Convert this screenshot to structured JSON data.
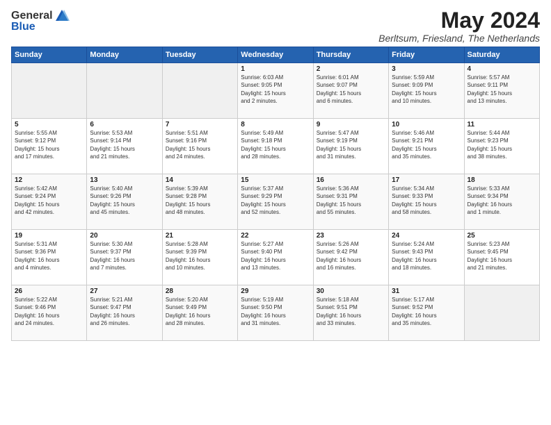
{
  "header": {
    "logo_general": "General",
    "logo_blue": "Blue",
    "title": "May 2024",
    "subtitle": "Berltsum, Friesland, The Netherlands"
  },
  "days_of_week": [
    "Sunday",
    "Monday",
    "Tuesday",
    "Wednesday",
    "Thursday",
    "Friday",
    "Saturday"
  ],
  "weeks": [
    [
      {
        "day": "",
        "info": ""
      },
      {
        "day": "",
        "info": ""
      },
      {
        "day": "",
        "info": ""
      },
      {
        "day": "1",
        "info": "Sunrise: 6:03 AM\nSunset: 9:05 PM\nDaylight: 15 hours\nand 2 minutes."
      },
      {
        "day": "2",
        "info": "Sunrise: 6:01 AM\nSunset: 9:07 PM\nDaylight: 15 hours\nand 6 minutes."
      },
      {
        "day": "3",
        "info": "Sunrise: 5:59 AM\nSunset: 9:09 PM\nDaylight: 15 hours\nand 10 minutes."
      },
      {
        "day": "4",
        "info": "Sunrise: 5:57 AM\nSunset: 9:11 PM\nDaylight: 15 hours\nand 13 minutes."
      }
    ],
    [
      {
        "day": "5",
        "info": "Sunrise: 5:55 AM\nSunset: 9:12 PM\nDaylight: 15 hours\nand 17 minutes."
      },
      {
        "day": "6",
        "info": "Sunrise: 5:53 AM\nSunset: 9:14 PM\nDaylight: 15 hours\nand 21 minutes."
      },
      {
        "day": "7",
        "info": "Sunrise: 5:51 AM\nSunset: 9:16 PM\nDaylight: 15 hours\nand 24 minutes."
      },
      {
        "day": "8",
        "info": "Sunrise: 5:49 AM\nSunset: 9:18 PM\nDaylight: 15 hours\nand 28 minutes."
      },
      {
        "day": "9",
        "info": "Sunrise: 5:47 AM\nSunset: 9:19 PM\nDaylight: 15 hours\nand 31 minutes."
      },
      {
        "day": "10",
        "info": "Sunrise: 5:46 AM\nSunset: 9:21 PM\nDaylight: 15 hours\nand 35 minutes."
      },
      {
        "day": "11",
        "info": "Sunrise: 5:44 AM\nSunset: 9:23 PM\nDaylight: 15 hours\nand 38 minutes."
      }
    ],
    [
      {
        "day": "12",
        "info": "Sunrise: 5:42 AM\nSunset: 9:24 PM\nDaylight: 15 hours\nand 42 minutes."
      },
      {
        "day": "13",
        "info": "Sunrise: 5:40 AM\nSunset: 9:26 PM\nDaylight: 15 hours\nand 45 minutes."
      },
      {
        "day": "14",
        "info": "Sunrise: 5:39 AM\nSunset: 9:28 PM\nDaylight: 15 hours\nand 48 minutes."
      },
      {
        "day": "15",
        "info": "Sunrise: 5:37 AM\nSunset: 9:29 PM\nDaylight: 15 hours\nand 52 minutes."
      },
      {
        "day": "16",
        "info": "Sunrise: 5:36 AM\nSunset: 9:31 PM\nDaylight: 15 hours\nand 55 minutes."
      },
      {
        "day": "17",
        "info": "Sunrise: 5:34 AM\nSunset: 9:33 PM\nDaylight: 15 hours\nand 58 minutes."
      },
      {
        "day": "18",
        "info": "Sunrise: 5:33 AM\nSunset: 9:34 PM\nDaylight: 16 hours\nand 1 minute."
      }
    ],
    [
      {
        "day": "19",
        "info": "Sunrise: 5:31 AM\nSunset: 9:36 PM\nDaylight: 16 hours\nand 4 minutes."
      },
      {
        "day": "20",
        "info": "Sunrise: 5:30 AM\nSunset: 9:37 PM\nDaylight: 16 hours\nand 7 minutes."
      },
      {
        "day": "21",
        "info": "Sunrise: 5:28 AM\nSunset: 9:39 PM\nDaylight: 16 hours\nand 10 minutes."
      },
      {
        "day": "22",
        "info": "Sunrise: 5:27 AM\nSunset: 9:40 PM\nDaylight: 16 hours\nand 13 minutes."
      },
      {
        "day": "23",
        "info": "Sunrise: 5:26 AM\nSunset: 9:42 PM\nDaylight: 16 hours\nand 16 minutes."
      },
      {
        "day": "24",
        "info": "Sunrise: 5:24 AM\nSunset: 9:43 PM\nDaylight: 16 hours\nand 18 minutes."
      },
      {
        "day": "25",
        "info": "Sunrise: 5:23 AM\nSunset: 9:45 PM\nDaylight: 16 hours\nand 21 minutes."
      }
    ],
    [
      {
        "day": "26",
        "info": "Sunrise: 5:22 AM\nSunset: 9:46 PM\nDaylight: 16 hours\nand 24 minutes."
      },
      {
        "day": "27",
        "info": "Sunrise: 5:21 AM\nSunset: 9:47 PM\nDaylight: 16 hours\nand 26 minutes."
      },
      {
        "day": "28",
        "info": "Sunrise: 5:20 AM\nSunset: 9:49 PM\nDaylight: 16 hours\nand 28 minutes."
      },
      {
        "day": "29",
        "info": "Sunrise: 5:19 AM\nSunset: 9:50 PM\nDaylight: 16 hours\nand 31 minutes."
      },
      {
        "day": "30",
        "info": "Sunrise: 5:18 AM\nSunset: 9:51 PM\nDaylight: 16 hours\nand 33 minutes."
      },
      {
        "day": "31",
        "info": "Sunrise: 5:17 AM\nSunset: 9:52 PM\nDaylight: 16 hours\nand 35 minutes."
      },
      {
        "day": "",
        "info": ""
      }
    ]
  ]
}
